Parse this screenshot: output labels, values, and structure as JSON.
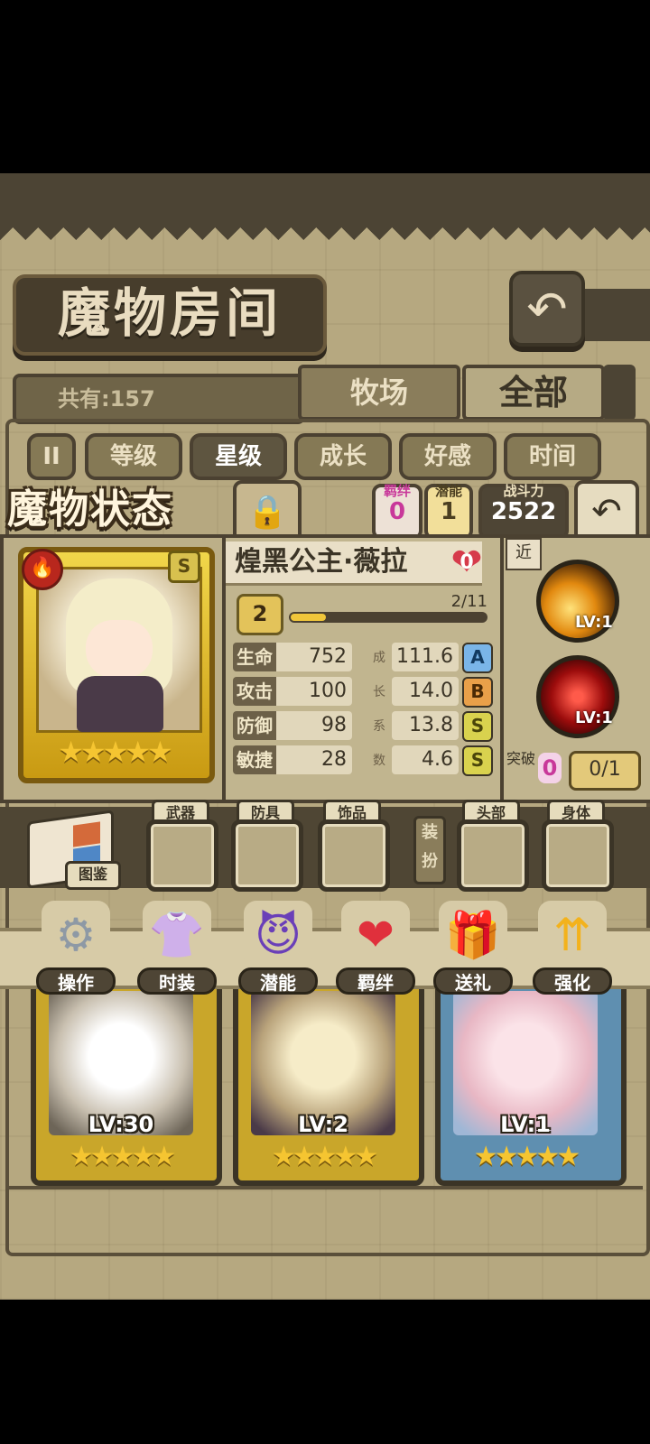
{
  "header": {
    "title": "魔物房间",
    "total_count": "共有:157",
    "tabs": [
      {
        "label": "牧场"
      },
      {
        "label": "全部"
      }
    ]
  },
  "sort_buttons": [
    {
      "label": "等级"
    },
    {
      "label": "星级",
      "active": true
    },
    {
      "label": "成长"
    },
    {
      "label": "好感"
    },
    {
      "label": "时间"
    }
  ],
  "status": {
    "title": "魔物状态",
    "bond_label": "羁绊",
    "bond_value": "0",
    "potential_label": "潜能",
    "potential_value": "1",
    "power_label": "战斗力",
    "power_value": "2522",
    "monster_name": "煌黑公主·薇拉",
    "affection": "0",
    "rank": "S",
    "level": "2",
    "xp_text": "2/11",
    "xp_fraction": 0.18,
    "stars": "★★★★★",
    "growth_label_chars": [
      "成",
      "长",
      "系",
      "数"
    ],
    "stats": [
      {
        "label": "生命",
        "value": "752",
        "growth": "111.6",
        "grade": "A"
      },
      {
        "label": "攻击",
        "value": "100",
        "growth": "14.0",
        "grade": "B"
      },
      {
        "label": "防御",
        "value": "98",
        "growth": "13.8",
        "grade": "S"
      },
      {
        "label": "敏捷",
        "value": "28",
        "growth": "4.6",
        "grade": "S"
      }
    ],
    "range_tag": "近",
    "skills": [
      {
        "level": "LV:1"
      },
      {
        "level": "LV:1"
      }
    ],
    "breakthrough_label": "突破",
    "breakthrough_value": "0",
    "breakthrough_progress": "0/1"
  },
  "equipment": {
    "book_label": "图鉴",
    "dress_label": "装扮",
    "slots": [
      {
        "label": "武器"
      },
      {
        "label": "防具"
      },
      {
        "label": "饰品"
      },
      {
        "label": "头部"
      },
      {
        "label": "身体"
      }
    ]
  },
  "actions": [
    {
      "label": "操作",
      "icon": "gear-icon",
      "color": "#b9c2cc"
    },
    {
      "label": "时装",
      "icon": "outfit-icon",
      "color": "#f3a9d6"
    },
    {
      "label": "潜能",
      "icon": "demon-icon",
      "color": "#6a3fb8"
    },
    {
      "label": "羁绊",
      "icon": "hearts-icon",
      "color": "#e0303c"
    },
    {
      "label": "送礼",
      "icon": "gift-icon",
      "color": "#f2d24a"
    },
    {
      "label": "强化",
      "icon": "upgrade-arrows-icon",
      "color": "#f3b21c"
    }
  ],
  "monster_cards": [
    {
      "level": "LV:30",
      "stars": "★★★★★",
      "frame": "#c9a62a"
    },
    {
      "level": "LV:2",
      "stars": "★★★★★",
      "frame": "#c9a62a"
    },
    {
      "level": "LV:1",
      "stars": "★★★★★",
      "frame": "#5f8fb0"
    }
  ],
  "icons": {
    "back": "↶",
    "lock": "🔒",
    "fire": "🔥",
    "heart": "❤"
  }
}
